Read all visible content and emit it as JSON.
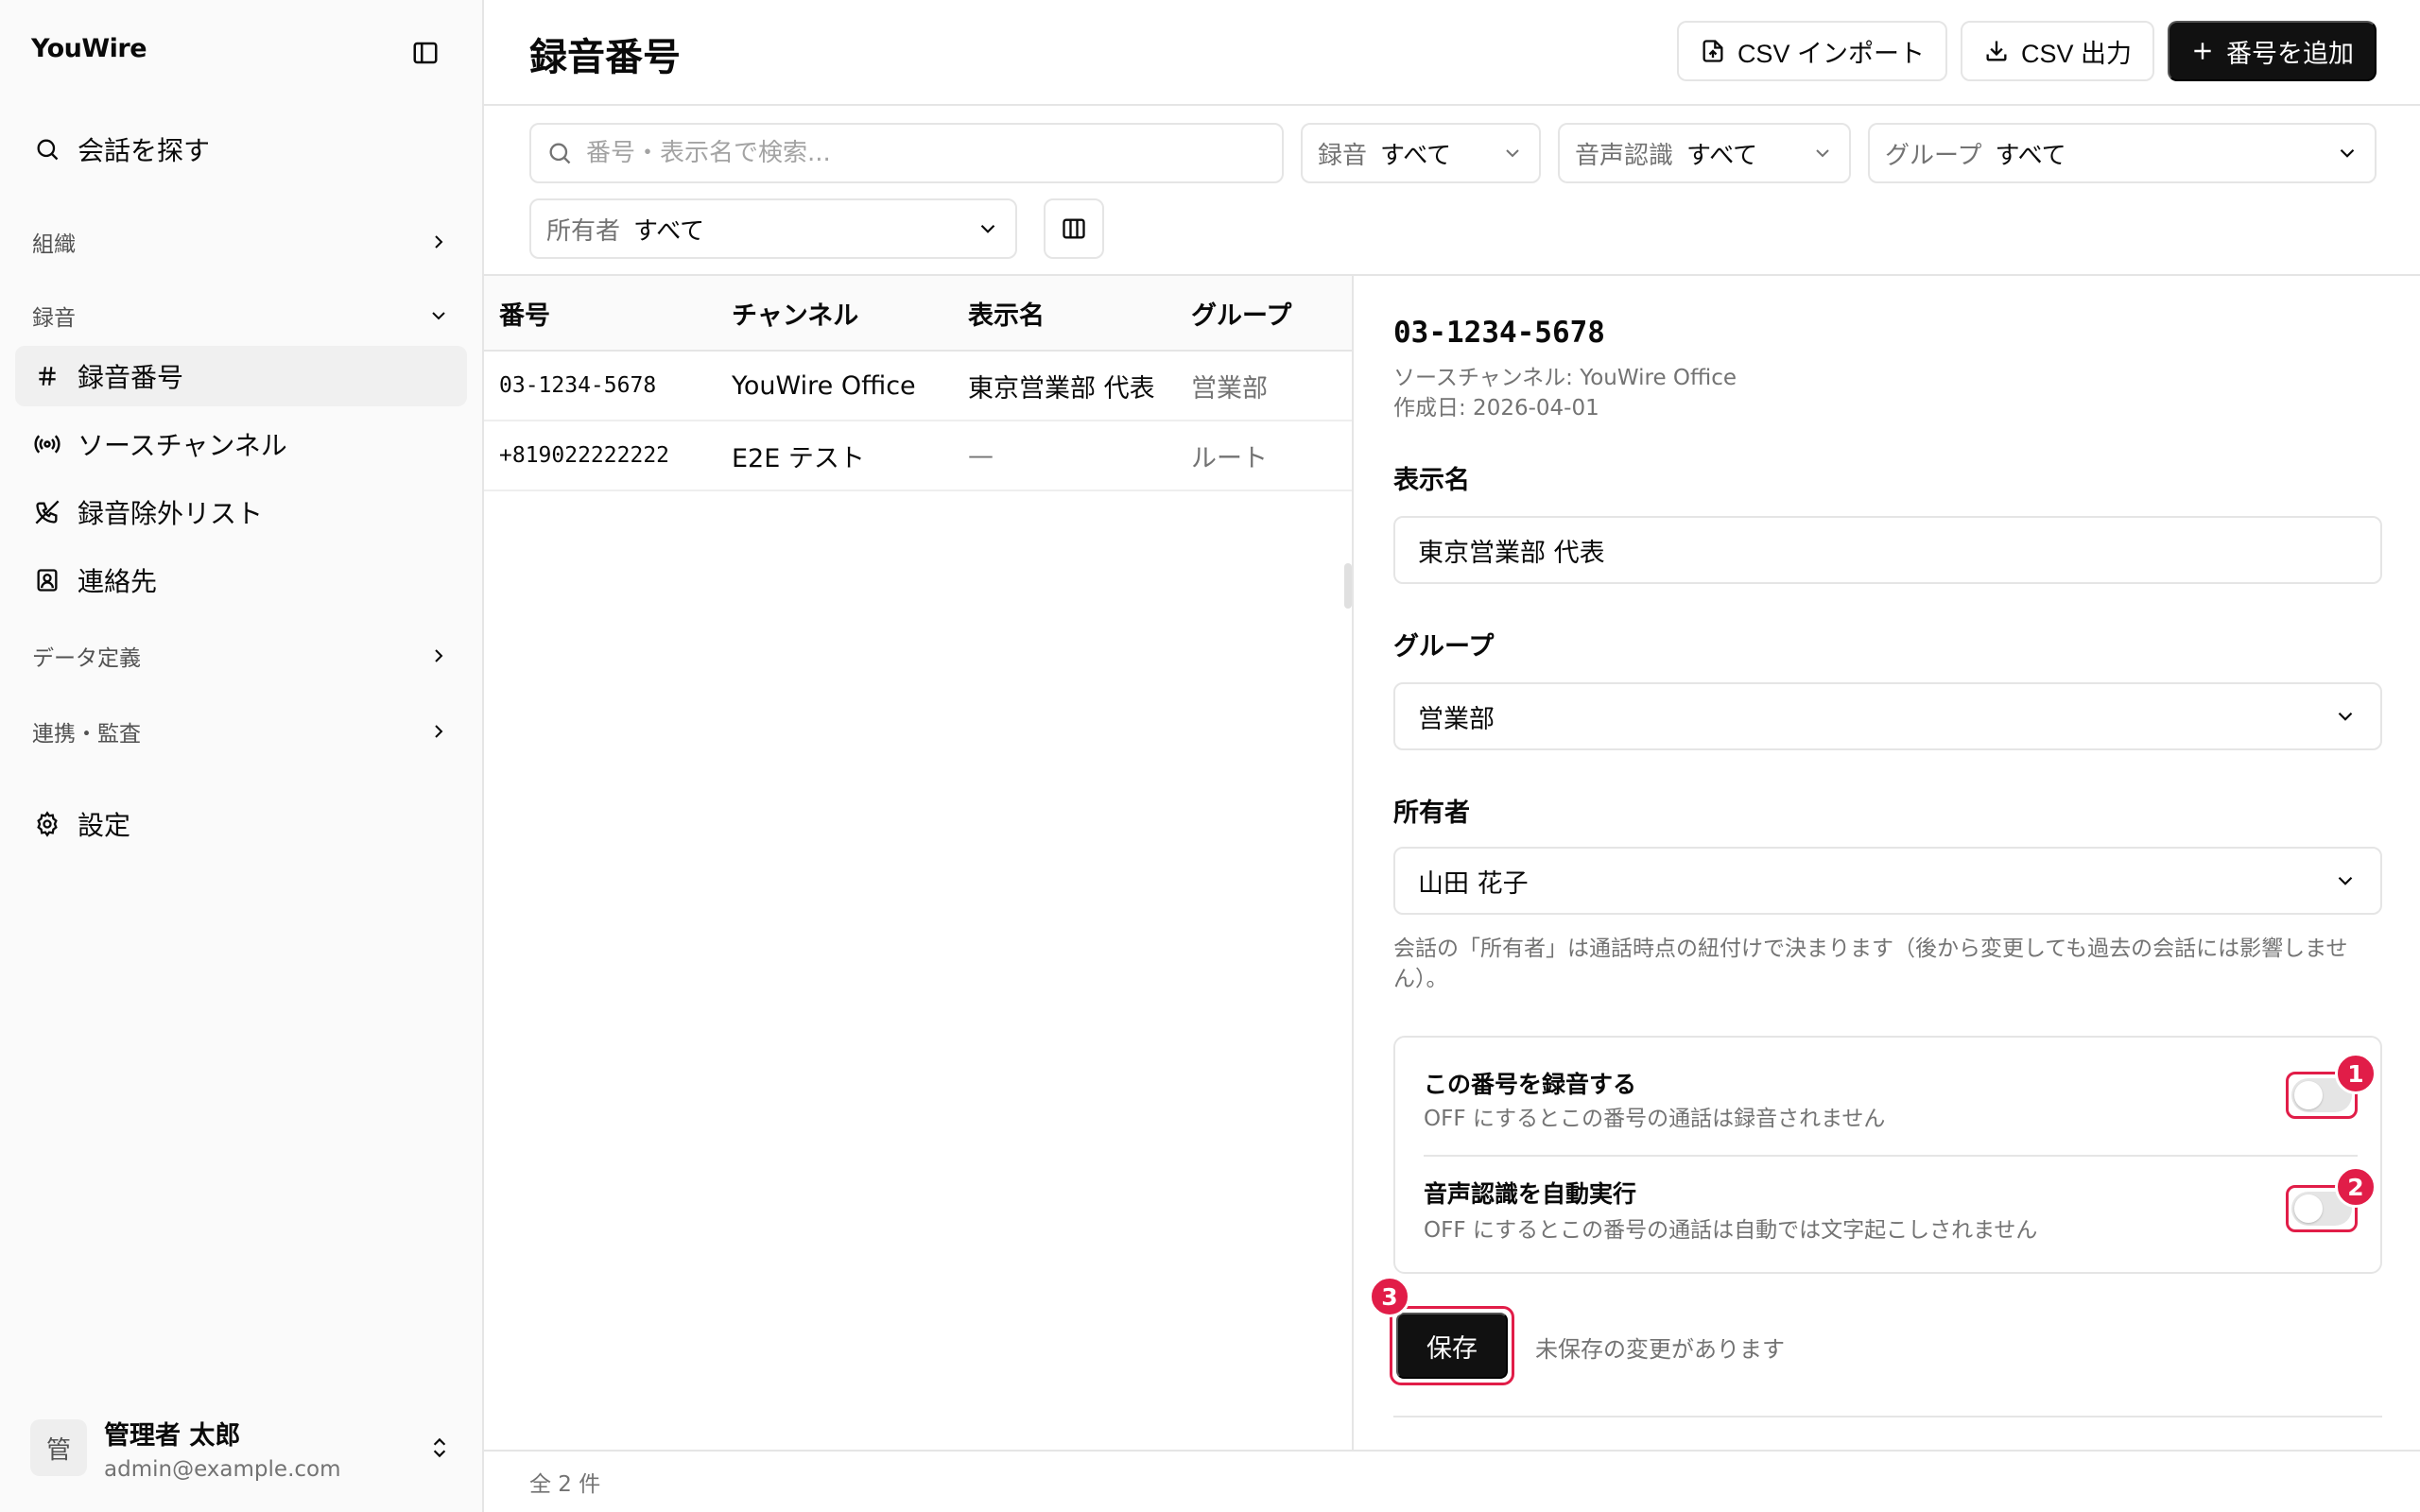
{
  "sidebar": {
    "brand": "YouWire",
    "search_label": "会話を探す",
    "sections": {
      "org": "組織",
      "recording": "録音",
      "data_def": "データ定義",
      "integration": "連携・監査"
    },
    "items": {
      "numbers": "録音番号",
      "channels": "ソースチャンネル",
      "exclusions": "録音除外リスト",
      "contacts": "連絡先"
    },
    "settings": "設定",
    "user": {
      "initial": "管",
      "name": "管理者 太郎",
      "email": "admin@example.com"
    }
  },
  "header": {
    "title": "録音番号",
    "csv_import": "CSV インポート",
    "csv_export": "CSV 出力",
    "add_number": "番号を追加"
  },
  "filters": {
    "search_placeholder": "番号・表示名で検索...",
    "recording": {
      "label": "録音",
      "value": "すべて"
    },
    "asr": {
      "label": "音声認識",
      "value": "すべて"
    },
    "group": {
      "label": "グループ",
      "value": "すべて"
    },
    "owner": {
      "label": "所有者",
      "value": "すべて"
    }
  },
  "table": {
    "columns": [
      "番号",
      "チャンネル",
      "表示名",
      "グループ"
    ],
    "rows": [
      {
        "number": "03-1234-5678",
        "channel": "YouWire Office",
        "display_name": "東京営業部 代表",
        "group": "営業部"
      },
      {
        "number": "+819022222222",
        "channel": "E2E テスト",
        "display_name": "—",
        "group": "ルート"
      }
    ]
  },
  "detail": {
    "number": "03-1234-5678",
    "source_channel": "ソースチャンネル: YouWire Office",
    "created": "作成日: 2026-04-01",
    "display_name_label": "表示名",
    "display_name_value": "東京営業部 代表",
    "group_label": "グループ",
    "group_value": "営業部",
    "owner_label": "所有者",
    "owner_value": "山田 花子",
    "owner_help": "会話の「所有者」は通話時点の紐付けで決まります（後から変更しても過去の会話には影響しません）。",
    "record_toggle": {
      "title": "この番号を録音する",
      "desc": "OFF にするとこの番号の通話は録音されません",
      "on": false,
      "badge": "1"
    },
    "asr_toggle": {
      "title": "音声認識を自動実行",
      "desc": "OFF にするとこの番号の通話は自動では文字起こしされません",
      "on": false,
      "badge": "2"
    },
    "save_label": "保存",
    "save_badge": "3",
    "unsaved_text": "未保存の変更があります"
  },
  "footer": {
    "count": "全 2 件"
  },
  "colors": {
    "accent": "#e11d48",
    "primary": "#111111",
    "border": "#e5e5e5",
    "muted": "#737373"
  }
}
